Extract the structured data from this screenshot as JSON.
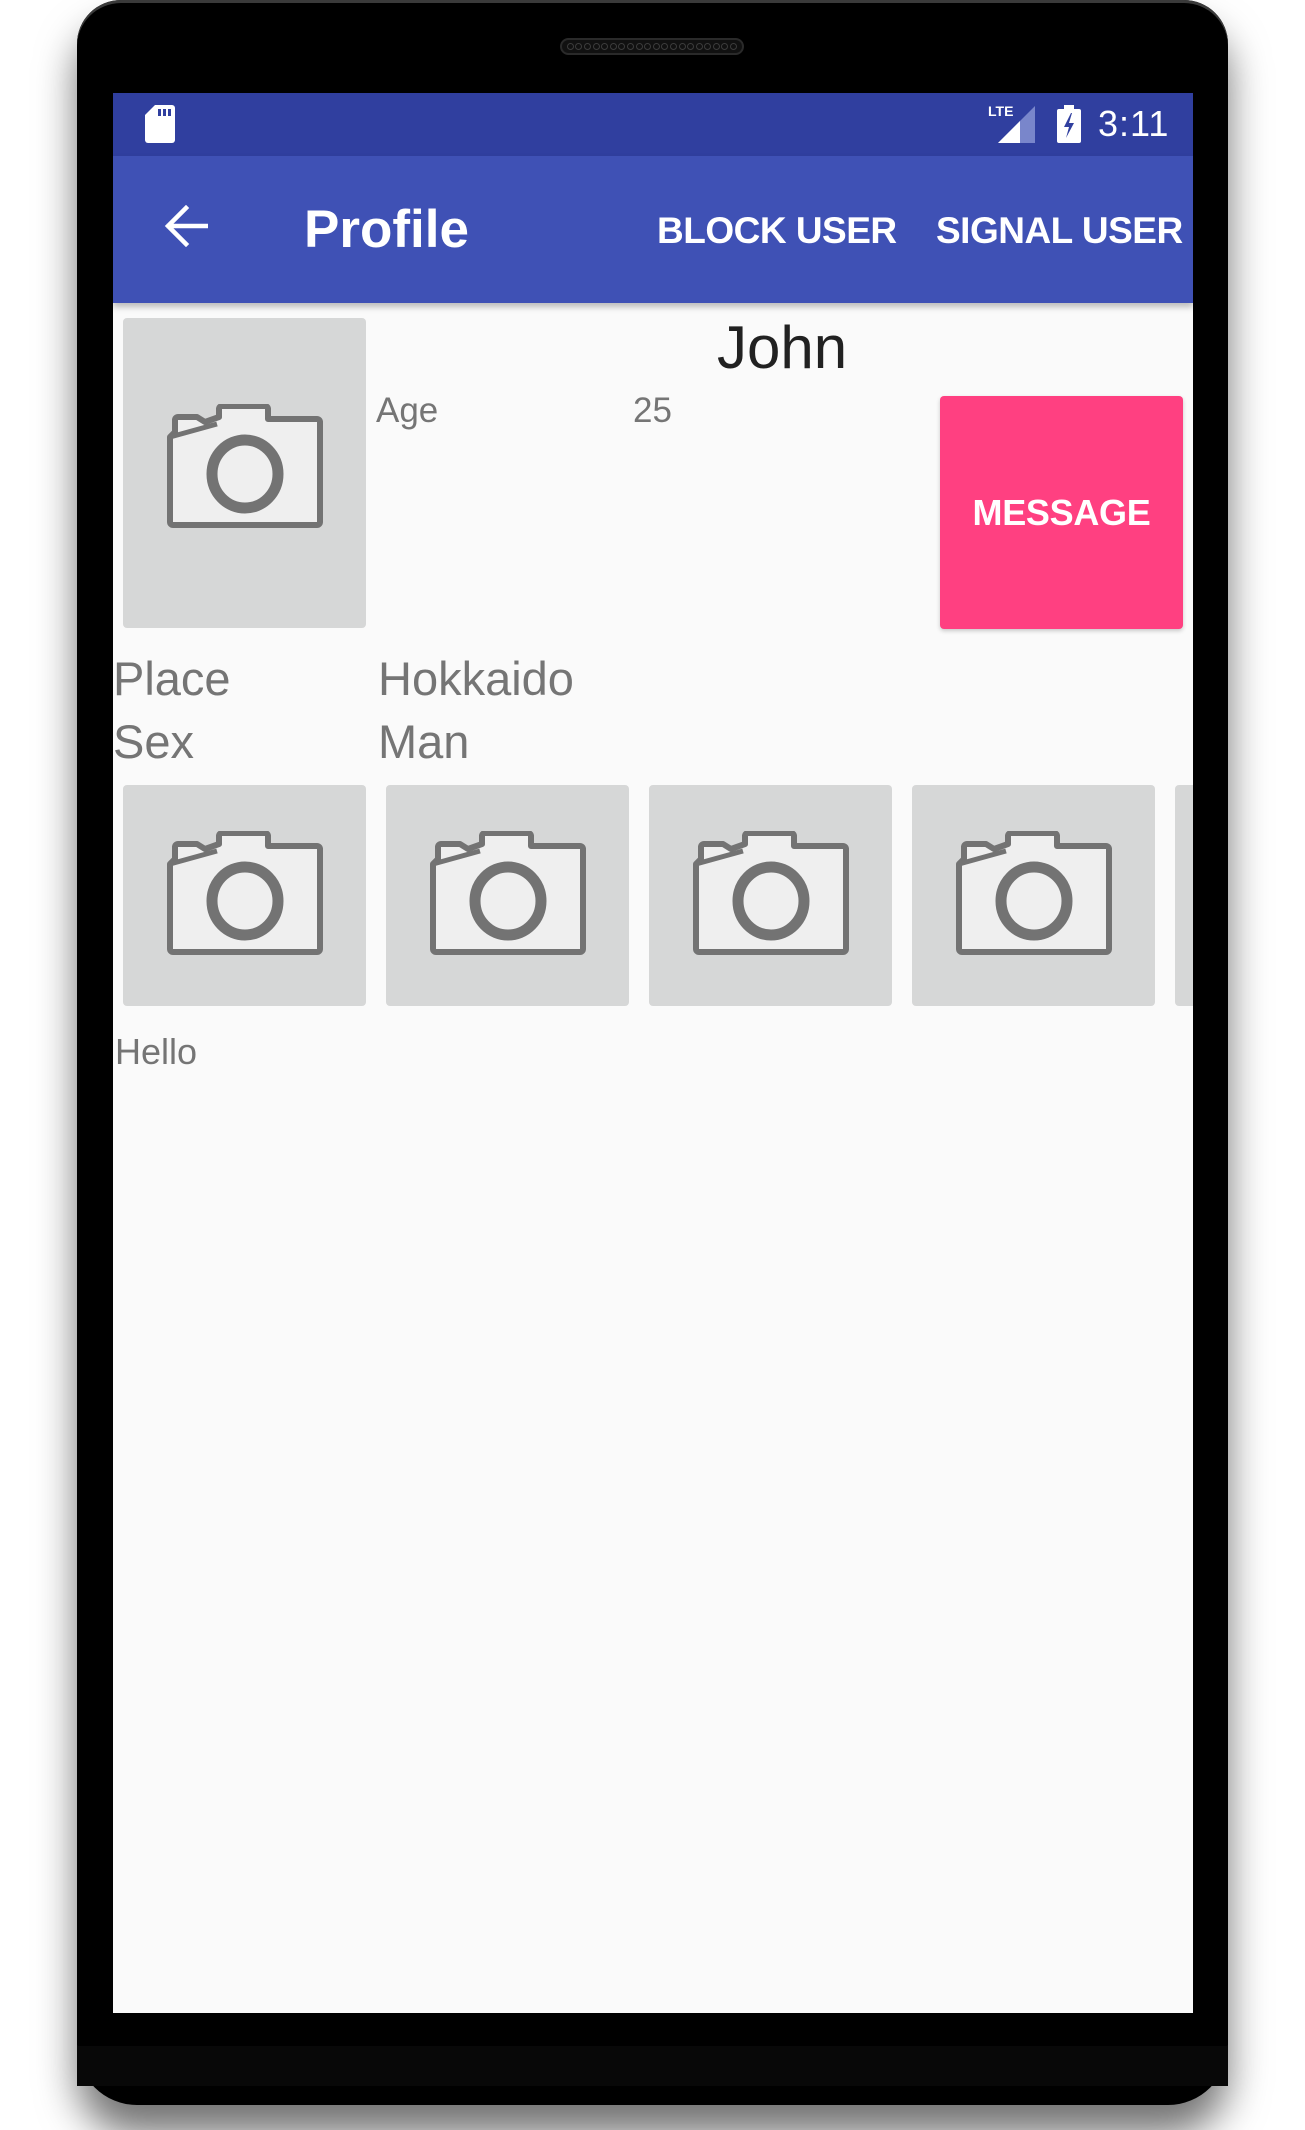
{
  "status_bar": {
    "left_icon": "sd-card-icon",
    "network": "LTE",
    "signal_icon": "signal-icon",
    "battery_icon": "battery-charging-icon",
    "time": "3:11",
    "color": "#303f9f"
  },
  "toolbar": {
    "back_icon": "arrow-back-icon",
    "title": "Profile",
    "actions": [
      {
        "label": "BLOCK USER"
      },
      {
        "label": "SIGNAL USER"
      }
    ],
    "color": "#3f51b5"
  },
  "profile": {
    "photo_icon": "camera-icon",
    "name": "John",
    "fields": [
      {
        "label": "Age",
        "value": "25"
      },
      {
        "label": "Place",
        "value": "Hokkaido"
      },
      {
        "label": "Sex",
        "value": "Man"
      }
    ],
    "message_button": {
      "label": "MESSAGE",
      "color": "#ff4081"
    },
    "gallery": [
      {
        "icon": "camera-icon"
      },
      {
        "icon": "camera-icon"
      },
      {
        "icon": "camera-icon"
      },
      {
        "icon": "camera-icon"
      },
      {
        "icon": "camera-icon"
      }
    ],
    "bio": "Hello"
  }
}
